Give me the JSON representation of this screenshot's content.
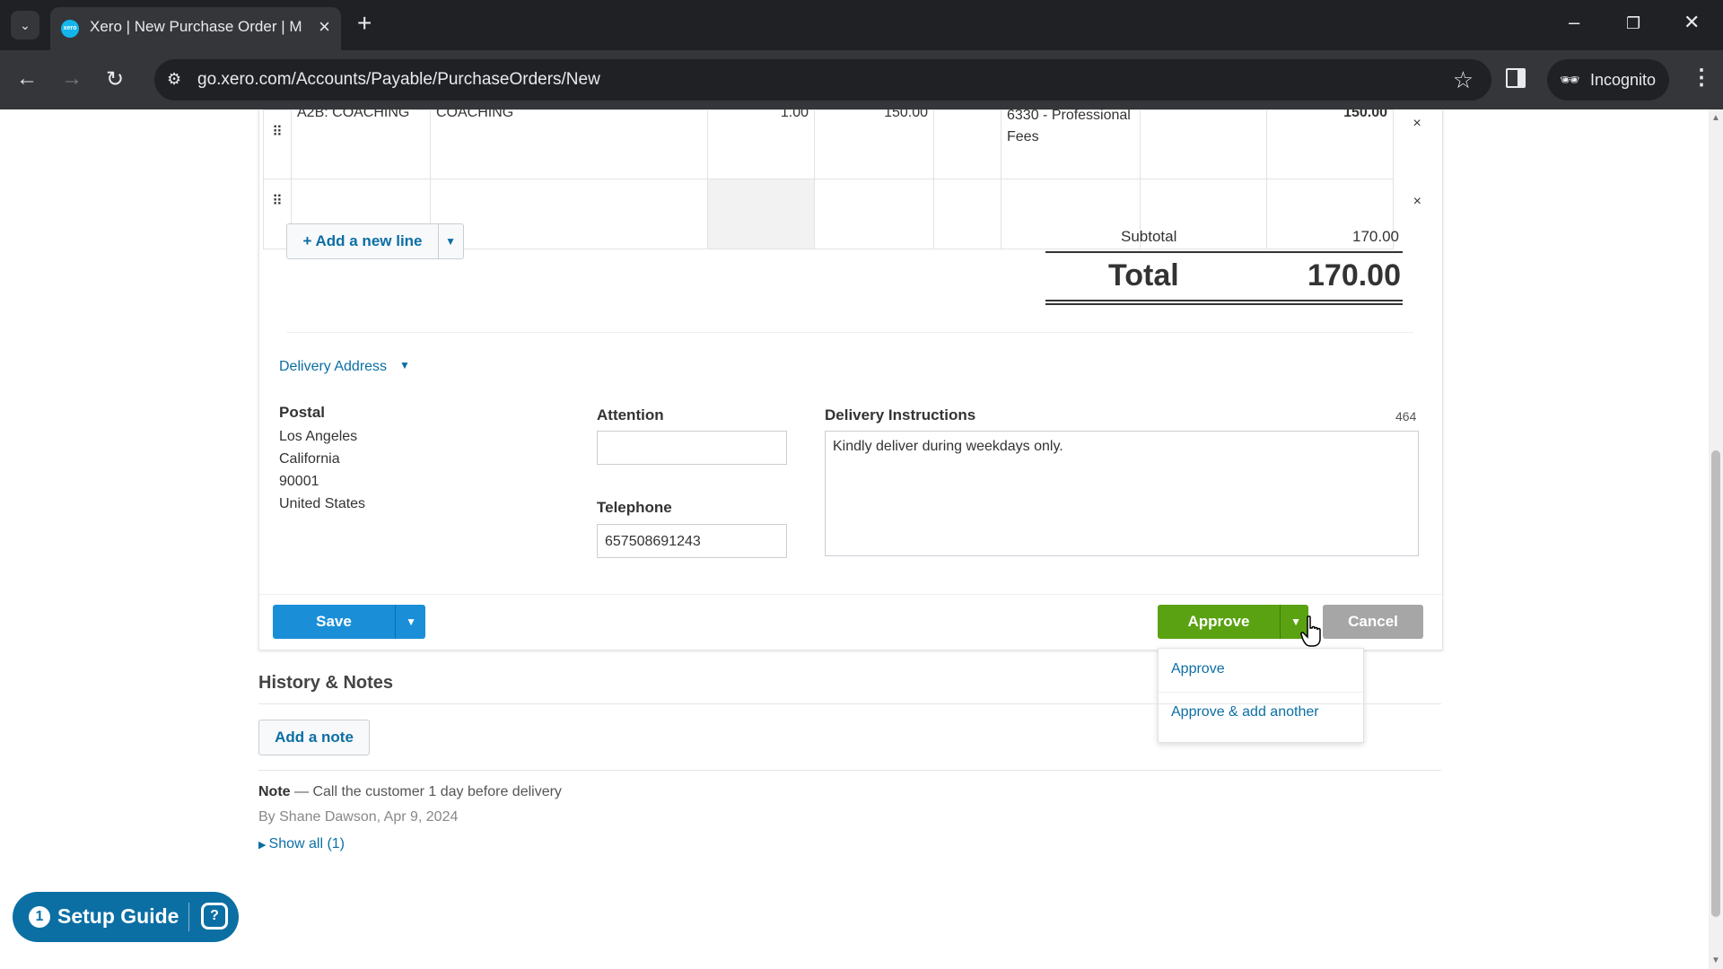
{
  "browser": {
    "tab_title": "Xero | New Purchase Order | M",
    "favicon_text": "xero",
    "url": "go.xero.com/Accounts/Payable/PurchaseOrders/New",
    "incognito_label": "Incognito"
  },
  "line_items": [
    {
      "item": "A2B: COACHING",
      "description": "COACHING",
      "qty": "1.00",
      "unit_price": "150.00",
      "disc": "",
      "account": "6330 - Professional Fees",
      "tax_rate": "",
      "amount": "150.00"
    },
    {
      "item": "",
      "description": "",
      "qty": "",
      "unit_price": "",
      "disc": "",
      "account": "",
      "tax_rate": "",
      "amount": ""
    }
  ],
  "add_line_label": "+ Add a new line",
  "totals": {
    "subtotal_label": "Subtotal",
    "subtotal_value": "170.00",
    "total_label": "Total",
    "total_value": "170.00"
  },
  "delivery": {
    "section_label": "Delivery Address",
    "postal_label": "Postal",
    "address_lines": [
      "Los Angeles",
      "California",
      "90001",
      "United States"
    ],
    "attention_label": "Attention",
    "attention_value": "",
    "telephone_label": "Telephone",
    "telephone_value": "657508691243",
    "instructions_label": "Delivery Instructions",
    "instructions_counter": "464",
    "instructions_value": "Kindly deliver during weekdays only."
  },
  "actions": {
    "save_label": "Save",
    "approve_label": "Approve",
    "cancel_label": "Cancel",
    "approve_menu": [
      "Approve",
      "Approve & add another"
    ]
  },
  "history": {
    "title": "History & Notes",
    "add_note_label": "Add a note",
    "note_prefix": "Note",
    "note_text": " — Call the customer 1 day before delivery",
    "note_by": "By Shane Dawson, Apr 9, 2024",
    "show_all": "Show all (1)"
  },
  "setup_guide": {
    "count": "1",
    "label": "Setup Guide"
  },
  "colors": {
    "approve_green": "#5aa212",
    "save_blue": "#1a8fd8",
    "link_blue": "#0b6fa4"
  }
}
